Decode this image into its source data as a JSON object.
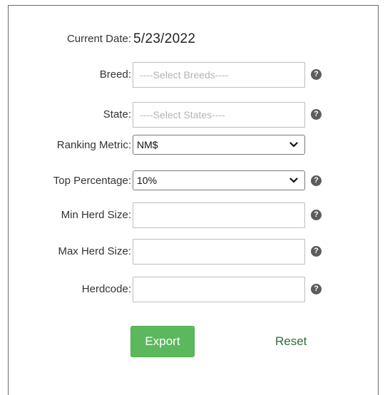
{
  "form": {
    "current_date_label": "Current Date:",
    "current_date_value": "5/23/2022",
    "breed": {
      "label": "Breed:",
      "placeholder": "----Select Breeds----"
    },
    "state": {
      "label": "State:",
      "placeholder": "----Select States----"
    },
    "ranking_metric": {
      "label": "Ranking Metric:",
      "value": "NM$"
    },
    "top_percentage": {
      "label": "Top Percentage:",
      "value": "10%"
    },
    "min_herd_size": {
      "label": "Min Herd Size:",
      "value": ""
    },
    "max_herd_size": {
      "label": "Max Herd Size:",
      "value": ""
    },
    "herdcode": {
      "label": "Herdcode:",
      "value": ""
    },
    "help_symbol": "?",
    "export_label": "Export",
    "reset_label": "Reset"
  },
  "colors": {
    "export_button": "#5cb85c",
    "reset_link": "#2e6e3b",
    "help_icon": "#5c5c5c"
  },
  "icons": {
    "help": "question-circle-icon",
    "dropdown": "chevron-down-icon"
  }
}
